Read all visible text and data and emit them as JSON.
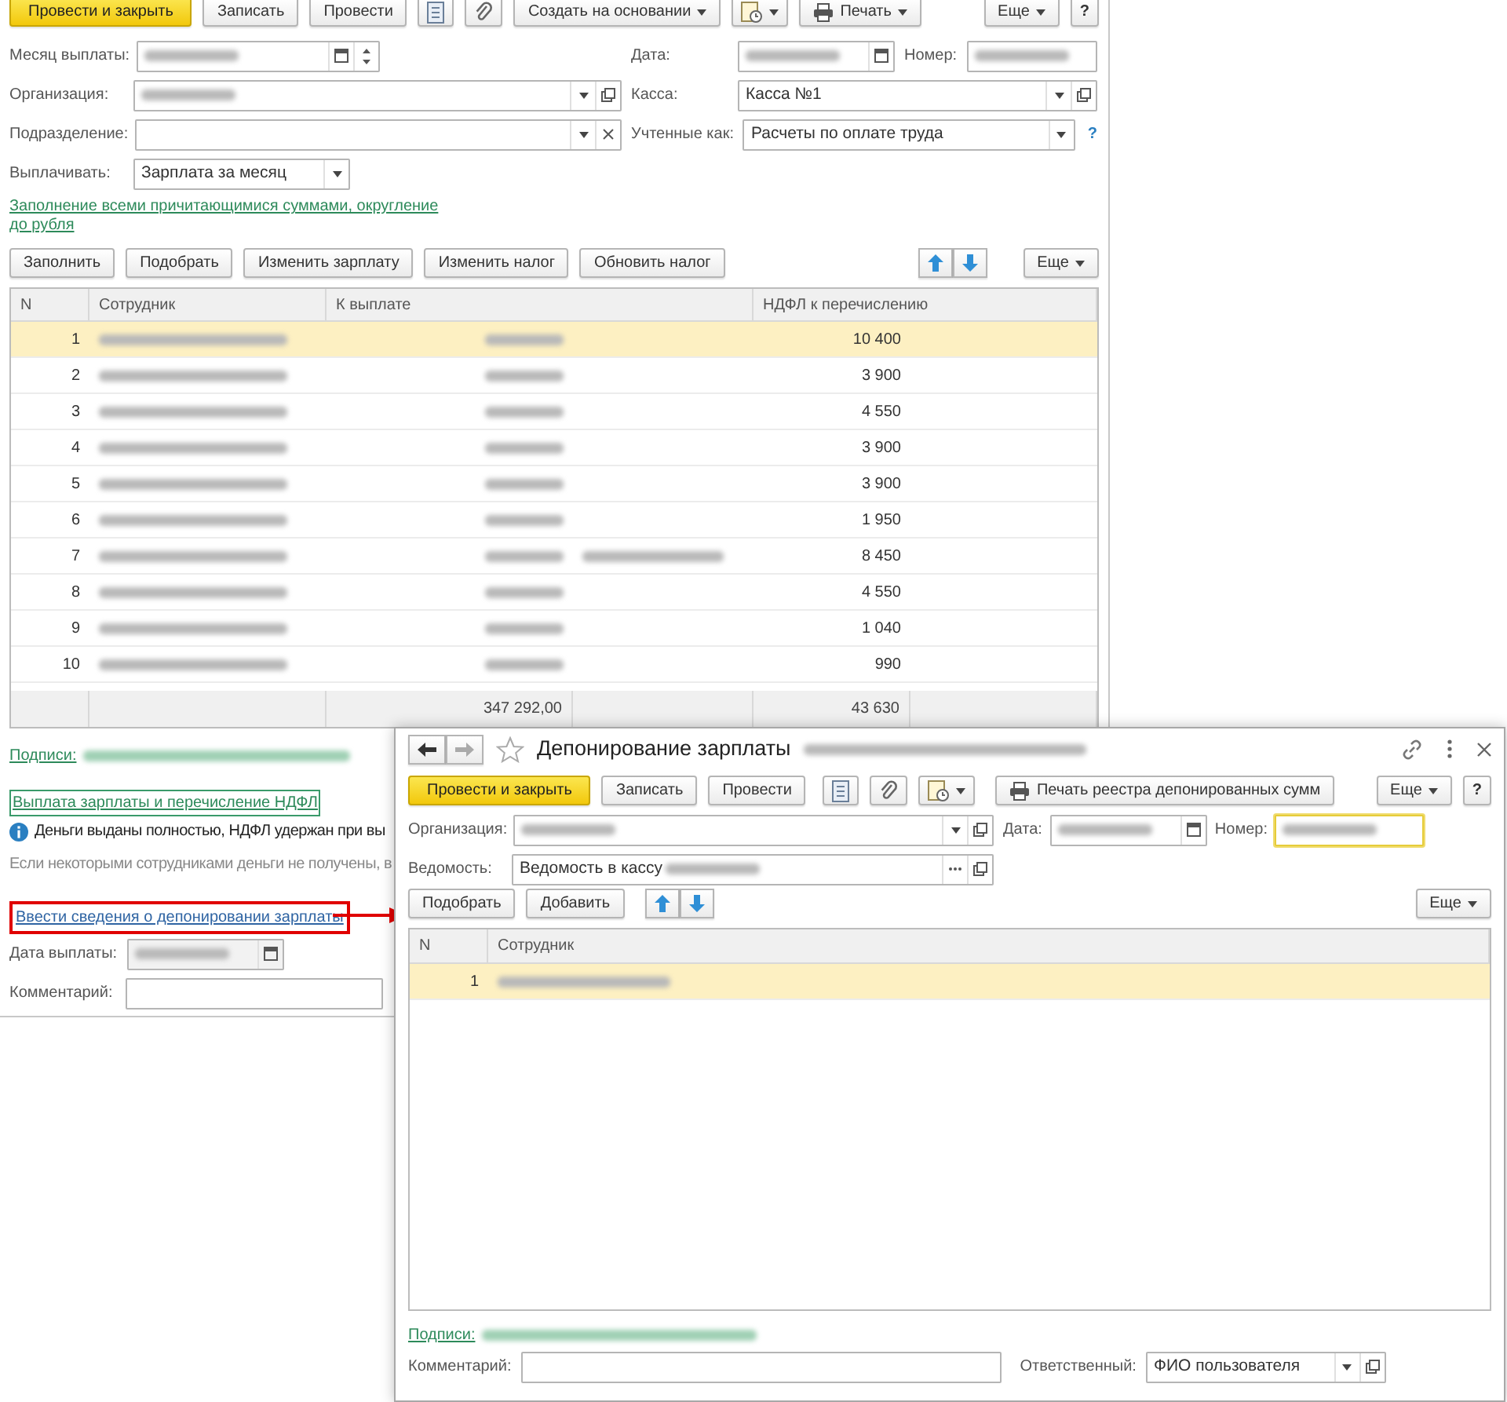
{
  "main_window": {
    "toolbar": [
      {
        "kind": "primary",
        "label": "Провести и закрыть"
      },
      {
        "kind": "button",
        "label": "Записать"
      },
      {
        "kind": "button",
        "label": "Провести"
      },
      {
        "kind": "document"
      },
      {
        "kind": "attach"
      },
      {
        "kind": "menu",
        "label": "Создать на основании"
      },
      {
        "kind": "report"
      },
      {
        "kind": "print-menu",
        "label": "Печать"
      },
      {
        "kind": "more",
        "label": "Еще"
      },
      {
        "kind": "help",
        "label": "?"
      }
    ],
    "field_rows": [
      [
        {
          "label": "Месяц выплаты:",
          "kind": "month",
          "value": {
            "redacted": true
          }
        },
        {
          "label": "Дата:",
          "kind": "date",
          "value": {
            "redacted": true
          }
        },
        {
          "label": "Номер:",
          "kind": "text",
          "value": {
            "redacted": true
          }
        }
      ],
      [
        {
          "label": "Организация:",
          "kind": "ref",
          "value": {
            "redacted": true
          }
        },
        {
          "label": "Касса:",
          "kind": "ref",
          "value": "Касса №1"
        }
      ],
      [
        {
          "label": "Подразделение:",
          "kind": "ref-clear"
        },
        {
          "label": "Учтенные как:",
          "kind": "select",
          "value": "Расчеты по оплате труда",
          "help": "?"
        }
      ],
      [
        {
          "label": "Выплачивать:",
          "kind": "select",
          "value": "Зарплата за месяц"
        }
      ]
    ],
    "fill_link": "Заполнение всеми причитающимися суммами, округление до рубля",
    "table_toolbar": [
      {
        "kind": "button",
        "label": "Заполнить"
      },
      {
        "kind": "button",
        "label": "Подобрать"
      },
      {
        "kind": "button",
        "label": "Изменить зарплату"
      },
      {
        "kind": "button",
        "label": "Изменить налог"
      },
      {
        "kind": "button",
        "label": "Обновить налог"
      },
      {
        "kind": "move"
      },
      {
        "kind": "more",
        "label": "Еще"
      }
    ],
    "table": {
      "columns": [
        "N",
        "Сотрудник",
        "К выплате",
        "НДФЛ к перечислению"
      ],
      "rows": [
        {
          "n": "1",
          "employee": {
            "redacted": true
          },
          "amount": {
            "redacted": true
          },
          "ndfl": "10 400",
          "selected": true
        },
        {
          "n": "2",
          "employee": {
            "redacted": true
          },
          "amount": {
            "redacted": true
          },
          "ndfl": "3 900",
          "selected": false
        },
        {
          "n": "3",
          "employee": {
            "redacted": true
          },
          "amount": {
            "redacted": true
          },
          "ndfl": "4 550",
          "selected": false
        },
        {
          "n": "4",
          "employee": {
            "redacted": true
          },
          "amount": {
            "redacted": true
          },
          "ndfl": "3 900",
          "selected": false
        },
        {
          "n": "5",
          "employee": {
            "redacted": true
          },
          "amount": {
            "redacted": true
          },
          "ndfl": "3 900",
          "selected": false
        },
        {
          "n": "6",
          "employee": {
            "redacted": true
          },
          "amount": {
            "redacted": true
          },
          "ndfl": "1 950",
          "selected": false
        },
        {
          "n": "7",
          "employee": {
            "redacted": true
          },
          "amount": {
            "redacted": true
          },
          "note": {
            "redacted": true
          },
          "ndfl": "8 450",
          "selected": false
        },
        {
          "n": "8",
          "employee": {
            "redacted": true
          },
          "amount": {
            "redacted": true
          },
          "ndfl": "4 550",
          "selected": false
        },
        {
          "n": "9",
          "employee": {
            "redacted": true
          },
          "amount": {
            "redacted": true
          },
          "ndfl": "1 040",
          "selected": false
        },
        {
          "n": "10",
          "employee": {
            "redacted": true
          },
          "amount": {
            "redacted": true
          },
          "ndfl": "990",
          "selected": false
        }
      ],
      "totals": {
        "amount": "347 292,00",
        "ndfl": "43 630"
      }
    },
    "signatures": {
      "label": "Подписи:",
      "value": {
        "redacted": true
      }
    },
    "payment_link": {
      "text": "Выплата зарплаты и перечисление НДФЛ",
      "focused": true
    },
    "info": "Деньги выданы полностью, НДФЛ удержан при вы",
    "note": "Если некоторыми сотрудниками деньги не получены, в",
    "deposit_link": {
      "text": "Ввести сведения о депонировании зарплаты",
      "highlighted": true
    },
    "pay_date": {
      "label": "Дата выплаты:",
      "kind": "date",
      "value": {
        "redacted": true
      }
    },
    "comment": {
      "label": "Комментарий:",
      "kind": "text"
    }
  },
  "dialog": {
    "title": "Депонирование зарплаты",
    "title_suffix": {
      "redacted": true
    },
    "toolbar": [
      {
        "kind": "primary",
        "label": "Провести и закрыть"
      },
      {
        "kind": "button",
        "label": "Записать"
      },
      {
        "kind": "button",
        "label": "Провести"
      },
      {
        "kind": "document"
      },
      {
        "kind": "attach"
      },
      {
        "kind": "report"
      },
      {
        "kind": "print",
        "label": "Печать реестра депонированных сумм"
      },
      {
        "kind": "more",
        "label": "Еще"
      },
      {
        "kind": "help",
        "label": "?"
      }
    ],
    "field_rows": [
      [
        {
          "label": "Организация:",
          "kind": "ref",
          "value": {
            "redacted": true
          },
          "focused": false
        },
        {
          "label": "Дата:",
          "kind": "date",
          "value": {
            "redacted": true
          },
          "focused": false
        },
        {
          "label": "Номер:",
          "kind": "text",
          "value": {
            "redacted": true
          },
          "focused": true
        }
      ],
      [
        {
          "label": "Ведомость:",
          "kind": "pick",
          "value": [
            "Ведомость в кассу",
            {
              "redacted": true
            }
          ],
          "focused": false
        }
      ]
    ],
    "table_toolbar": [
      {
        "kind": "button",
        "label": "Подобрать"
      },
      {
        "kind": "button",
        "label": "Добавить"
      },
      {
        "kind": "move"
      },
      {
        "kind": "more",
        "label": "Еще"
      }
    ],
    "table": {
      "columns": [
        "N",
        "Сотрудник"
      ],
      "rows": [
        {
          "n": "1",
          "employee": {
            "redacted": true
          },
          "selected": true
        }
      ]
    },
    "signatures": {
      "label": "Подписи:",
      "value": {
        "redacted": true
      }
    },
    "comment": {
      "label": "Комментарий:",
      "kind": "text"
    },
    "responsible": {
      "label": "Ответственный:",
      "kind": "ref",
      "value": "ФИО пользователя"
    }
  }
}
